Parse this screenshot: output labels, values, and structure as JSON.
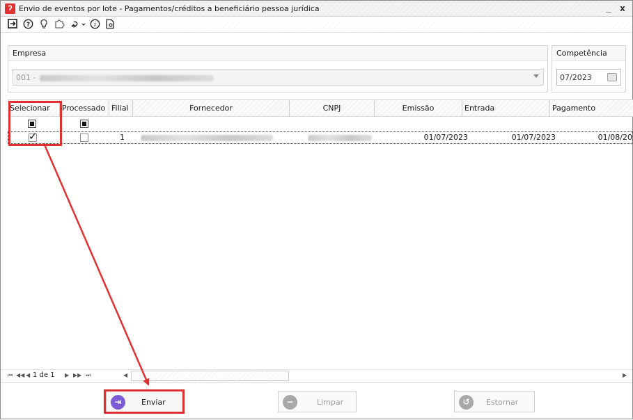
{
  "window": {
    "title": "Envio de eventos por lote - Pagamentos/créditos a beneficiário pessoa jurídica",
    "app_icon_glyph": "?",
    "minimize_glyph": "_",
    "close_glyph": "x"
  },
  "toolbar": {
    "icons": [
      "exit-icon",
      "help-icon",
      "lightbulb-icon",
      "puzzle-icon",
      "link-icon",
      "info-icon",
      "document-icon"
    ]
  },
  "filters": {
    "empresa_label": "Empresa",
    "empresa_value": "001 -",
    "competencia_label": "Competência",
    "competencia_value": "07/2023"
  },
  "grid": {
    "columns": [
      "Selecionar",
      "Processado",
      "Filial",
      "Fornecedor",
      "CNPJ",
      "Emissão",
      "Entrada",
      "Pagamento"
    ],
    "rows": [
      {
        "selecionar": true,
        "processado": false,
        "filial": "1",
        "fornecedor": "",
        "cnpj": "",
        "emissao": "01/07/2023",
        "entrada": "01/07/2023",
        "pagamento": "01/08/20"
      }
    ]
  },
  "pager": {
    "page_text": "1 de 1"
  },
  "buttons": {
    "enviar": "Enviar",
    "limpar": "Limpar",
    "estornar": "Estornar"
  },
  "colors": {
    "highlight": "#e03131",
    "enviar_icon": "#7b5cd6",
    "disabled_icon": "#a8a8a8"
  }
}
